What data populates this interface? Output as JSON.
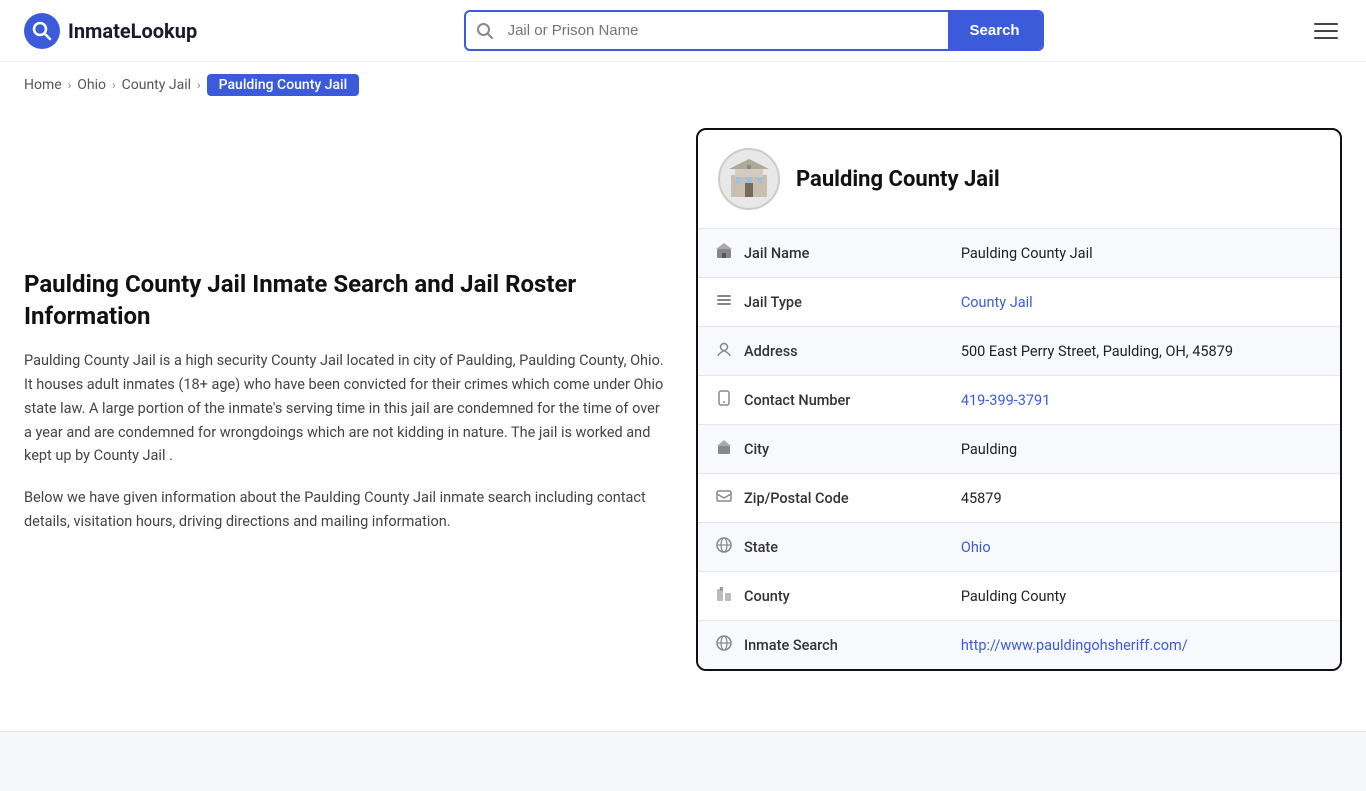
{
  "site": {
    "logo_text": "InmateLookup",
    "logo_q": "Q"
  },
  "header": {
    "search_placeholder": "Jail or Prison Name",
    "search_button": "Search",
    "hamburger_label": "Menu"
  },
  "breadcrumb": {
    "home": "Home",
    "state": "Ohio",
    "type": "County Jail",
    "current": "Paulding County Jail"
  },
  "left": {
    "heading": "Paulding County Jail Inmate Search and Jail Roster Information",
    "desc1": "Paulding County Jail is a high security County Jail located in city of Paulding, Paulding County, Ohio. It houses adult inmates (18+ age) who have been convicted for their crimes which come under Ohio state law. A large portion of the inmate's serving time in this jail are condemned for the time of over a year and are condemned for wrongdoings which are not kidding in nature. The jail is worked and kept up by County Jail .",
    "desc2": "Below we have given information about the Paulding County Jail inmate search including contact details, visitation hours, driving directions and mailing information."
  },
  "card": {
    "title": "Paulding County Jail",
    "rows": [
      {
        "icon": "jail-icon",
        "label": "Jail Name",
        "value": "Paulding County Jail",
        "link": false
      },
      {
        "icon": "type-icon",
        "label": "Jail Type",
        "value": "County Jail",
        "link": true,
        "href": "#"
      },
      {
        "icon": "address-icon",
        "label": "Address",
        "value": "500 East Perry Street, Paulding, OH, 45879",
        "link": false
      },
      {
        "icon": "phone-icon",
        "label": "Contact Number",
        "value": "419-399-3791",
        "link": true,
        "href": "tel:4193993791"
      },
      {
        "icon": "city-icon",
        "label": "City",
        "value": "Paulding",
        "link": false
      },
      {
        "icon": "zip-icon",
        "label": "Zip/Postal Code",
        "value": "45879",
        "link": false
      },
      {
        "icon": "state-icon",
        "label": "State",
        "value": "Ohio",
        "link": true,
        "href": "#"
      },
      {
        "icon": "county-icon",
        "label": "County",
        "value": "Paulding County",
        "link": false
      },
      {
        "icon": "web-icon",
        "label": "Inmate Search",
        "value": "http://www.pauldingohsheriff.com/",
        "link": true,
        "href": "http://www.pauldingohsheriff.com/"
      }
    ]
  }
}
